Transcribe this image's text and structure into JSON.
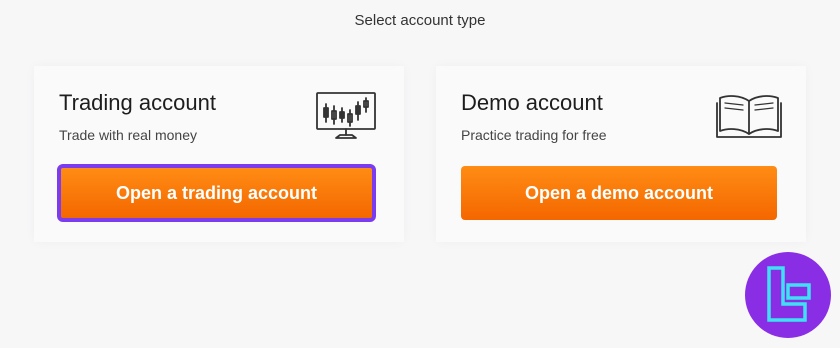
{
  "page": {
    "heading": "Select account type"
  },
  "cards": {
    "trading": {
      "title": "Trading account",
      "subtitle": "Trade with real money",
      "button_label": "Open a trading account",
      "icon": "candlestick-monitor-icon"
    },
    "demo": {
      "title": "Demo account",
      "subtitle": "Practice trading for free",
      "button_label": "Open a demo account",
      "icon": "open-book-icon"
    }
  },
  "colors": {
    "button_top": "#ff8c14",
    "button_bottom": "#f46700",
    "focus_ring": "#7b3cf0",
    "badge_bg": "#8a2ee6",
    "badge_mark": "#3fe0f2"
  },
  "badge": {
    "icon": "brand-logo-icon"
  }
}
